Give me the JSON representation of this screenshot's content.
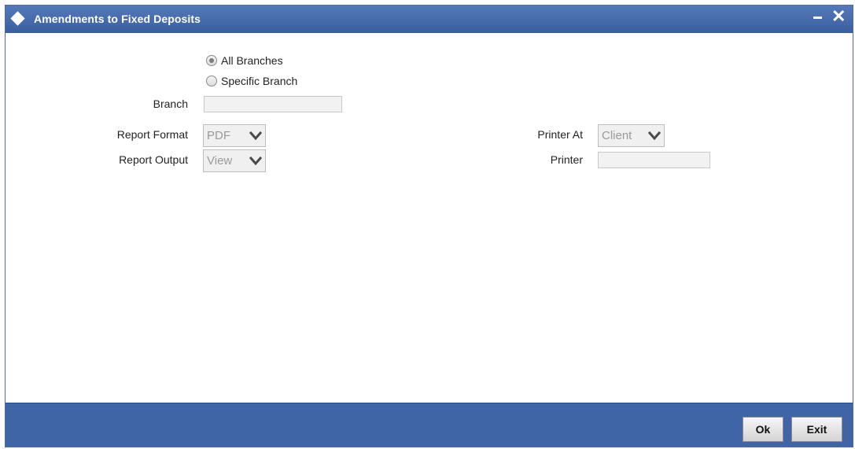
{
  "window": {
    "title": "Amendments to Fixed Deposits"
  },
  "branch_scope": {
    "options": [
      {
        "label": "All Branches",
        "checked": true
      },
      {
        "label": "Specific Branch",
        "checked": false
      }
    ]
  },
  "fields": {
    "branch_label": "Branch",
    "branch_value": "",
    "report_format_label": "Report Format",
    "report_format_value": "PDF",
    "report_output_label": "Report Output",
    "report_output_value": "View",
    "printer_at_label": "Printer At",
    "printer_at_value": "Client",
    "printer_label": "Printer",
    "printer_value": ""
  },
  "footer": {
    "ok_label": "Ok",
    "exit_label": "Exit"
  }
}
